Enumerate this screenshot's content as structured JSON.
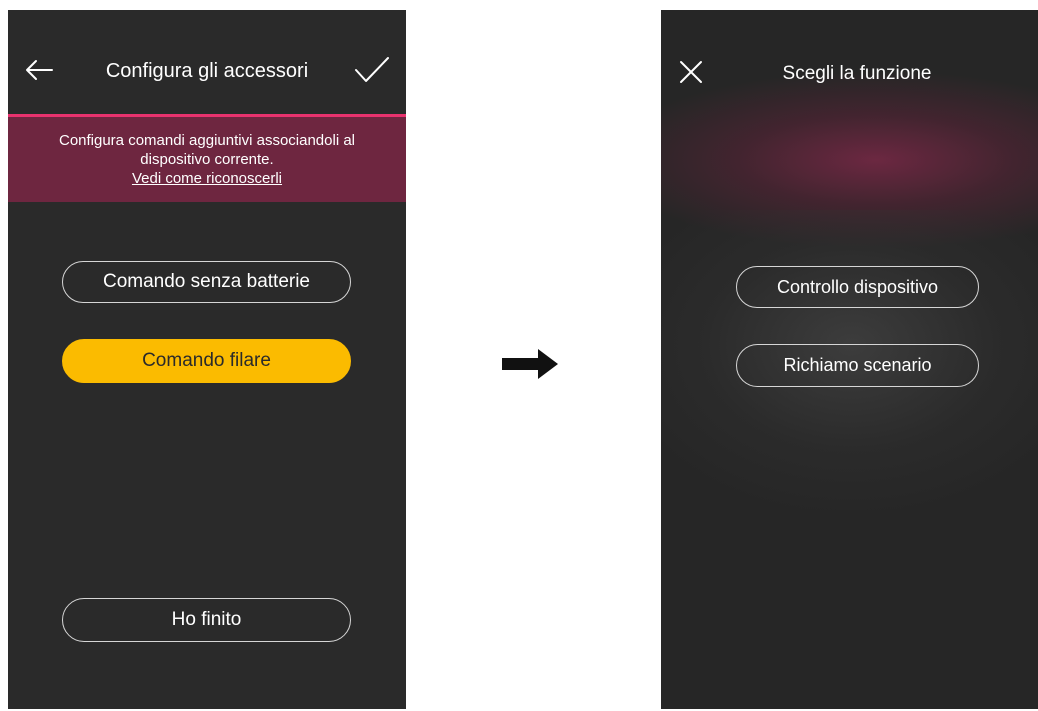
{
  "left_screen": {
    "title": "Configura gli accessori",
    "banner": {
      "line1": "Configura comandi aggiuntivi associandoli al",
      "line2": "dispositivo corrente.",
      "link": "Vedi come riconoscerli"
    },
    "buttons": {
      "senza_batterie": "Comando senza batterie",
      "filare": "Comando filare",
      "finito": "Ho finito"
    },
    "selected": "Comando filare"
  },
  "right_screen": {
    "title": "Scegli la funzione",
    "buttons": {
      "controllo": "Controllo dispositivo",
      "richiamo": "Richiamo scenario"
    }
  },
  "colors": {
    "screen_bg": "#2a2a2a",
    "accent_pink": "#e8326e",
    "banner_bg": "#6e2640",
    "selected_yellow": "#fbbb00"
  },
  "icons": {
    "back": "arrow-left-icon",
    "confirm": "checkmark-icon",
    "close": "close-icon",
    "flow": "arrow-right-icon"
  }
}
